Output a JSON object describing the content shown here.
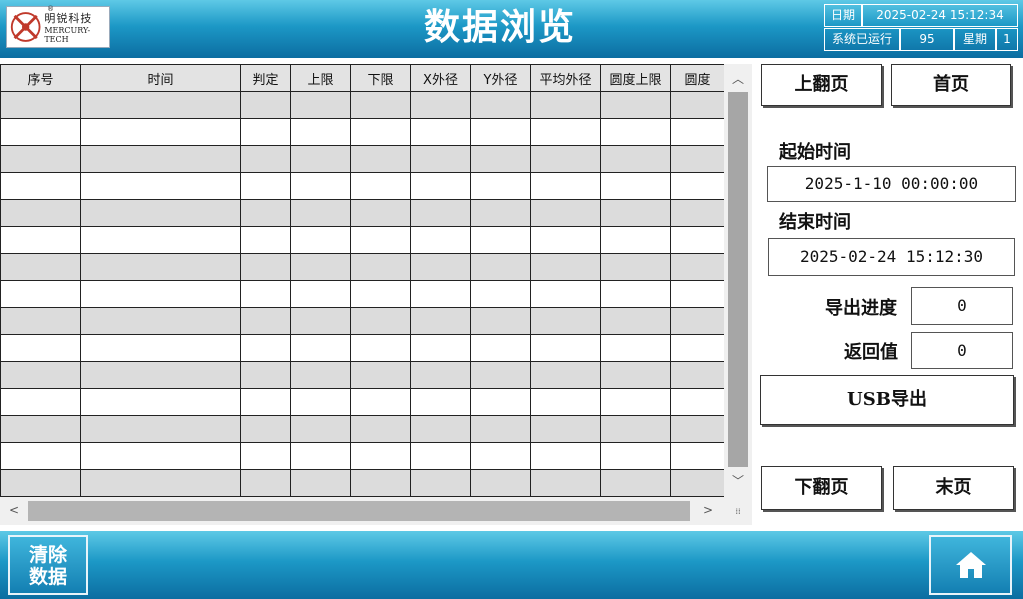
{
  "header": {
    "title": "数据浏览",
    "logo": {
      "cn": "明锐科技",
      "en": "MERCURY-TECH",
      "mark": "®"
    },
    "date_label": "日期",
    "date_value": "2025-02-24 15:12:34",
    "run_label": "系统已运行",
    "run_value": "95",
    "week_label": "星期",
    "week_value": "1"
  },
  "table": {
    "columns": [
      "序号",
      "时间",
      "判定",
      "上限",
      "下限",
      "X外径",
      "Y外径",
      "平均外径",
      "圆度上限",
      "圆度"
    ]
  },
  "panel": {
    "prev_page": "上翻页",
    "first_page": "首页",
    "start_time_label": "起始时间",
    "start_time_value": "2025-1-10 00:00:00",
    "end_time_label": "结束时间",
    "end_time_value": "2025-02-24 15:12:30",
    "export_progress_label": "导出进度",
    "export_progress_value": "0",
    "return_value_label": "返回值",
    "return_value": "0",
    "usb_export": "USB导出",
    "next_page": "下翻页",
    "last_page": "末页"
  },
  "footer": {
    "clear_line1": "清除",
    "clear_line2": "数据",
    "home_icon": "home-icon"
  },
  "colors": {
    "header_top": "#5ec9e6",
    "header_bottom": "#0c6da1",
    "row_shade": "#dcdcdc"
  }
}
